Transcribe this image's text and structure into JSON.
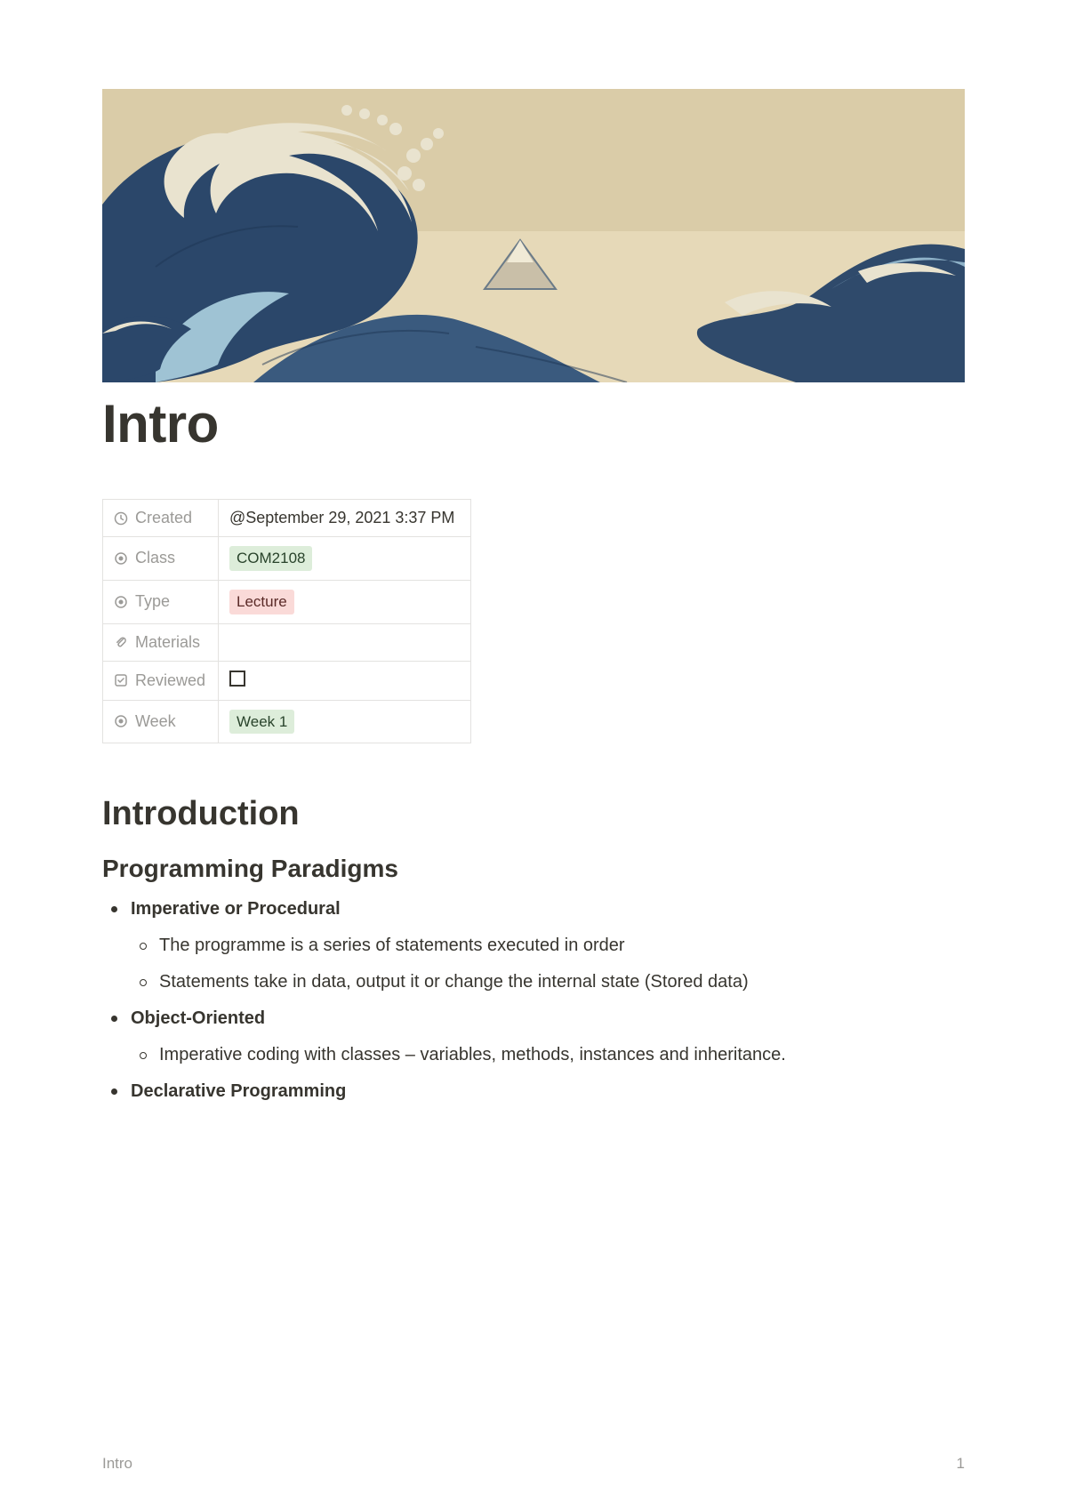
{
  "page": {
    "title": "Intro",
    "cover_alt": "The Great Wave off Kanagawa"
  },
  "properties": [
    {
      "icon": "clock",
      "label": "Created",
      "type": "text",
      "value": "@September 29, 2021 3:37 PM"
    },
    {
      "icon": "target",
      "label": "Class",
      "type": "tag",
      "value": "COM2108",
      "tag_class": "tag-green"
    },
    {
      "icon": "target",
      "label": "Type",
      "type": "tag",
      "value": "Lecture",
      "tag_class": "tag-red"
    },
    {
      "icon": "paperclip",
      "label": "Materials",
      "type": "text",
      "value": ""
    },
    {
      "icon": "checkbox",
      "label": "Reviewed",
      "type": "checkbox",
      "checked": false
    },
    {
      "icon": "target",
      "label": "Week",
      "type": "tag",
      "value": "Week 1",
      "tag_class": "tag-green"
    }
  ],
  "sections": {
    "h2": "Introduction",
    "h3": "Programming Paradigms",
    "bullets": [
      {
        "title": "Imperative or Procedural",
        "sub": [
          "The programme is a series of statements executed in order",
          "Statements take in data, output it or change the internal state (Stored data)"
        ]
      },
      {
        "title": "Object-Oriented",
        "sub": [
          "Imperative coding with classes – variables, methods, instances and inheritance."
        ]
      },
      {
        "title": "Declarative Programming",
        "sub": []
      }
    ]
  },
  "footer": {
    "left": "Intro",
    "right": "1"
  }
}
